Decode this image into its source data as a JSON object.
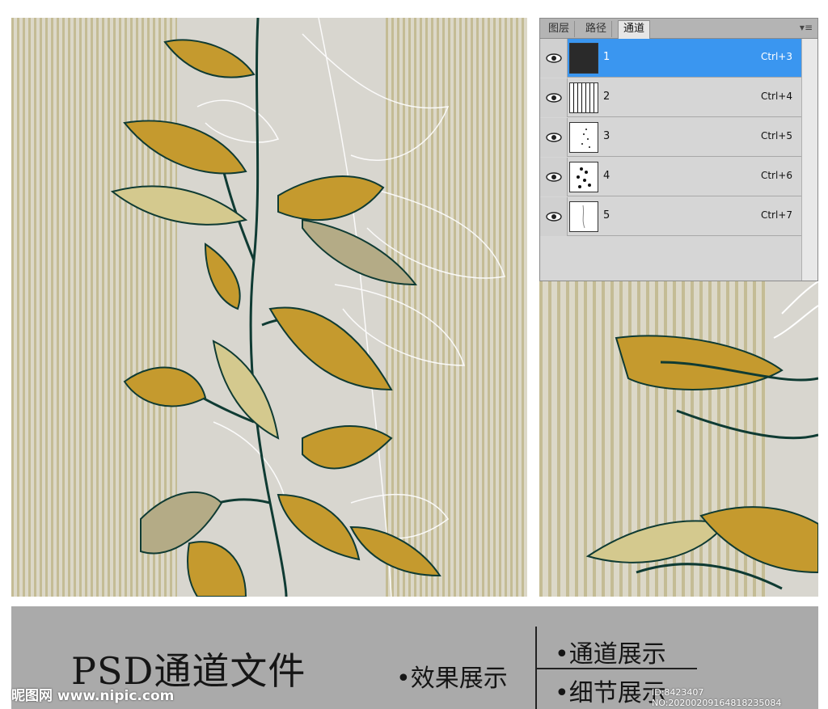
{
  "panel": {
    "tabs": [
      {
        "label": "图层",
        "active": false
      },
      {
        "label": "路径",
        "active": false
      },
      {
        "label": "通道",
        "active": true
      }
    ],
    "menu_icon": "panel-menu-icon",
    "channels": [
      {
        "name": "1",
        "shortcut": "Ctrl+3",
        "selected": true
      },
      {
        "name": "2",
        "shortcut": "Ctrl+4",
        "selected": false
      },
      {
        "name": "3",
        "shortcut": "Ctrl+5",
        "selected": false
      },
      {
        "name": "4",
        "shortcut": "Ctrl+6",
        "selected": false
      },
      {
        "name": "5",
        "shortcut": "Ctrl+7",
        "selected": false
      }
    ]
  },
  "caption": {
    "title": "PSD通道文件",
    "effect": "•效果展示",
    "channel": "•通道展示",
    "detail": "•细节展示"
  },
  "watermark": {
    "logo": "昵图网 www.nipic.com",
    "id_line": "ID:8423407 NO:20200209164818235084"
  },
  "colors": {
    "accent_selected": "#3a96f0",
    "leaf_dark": "#0f3b33",
    "leaf_gold": "#c59a2e",
    "stripe": "#c4bc95"
  }
}
